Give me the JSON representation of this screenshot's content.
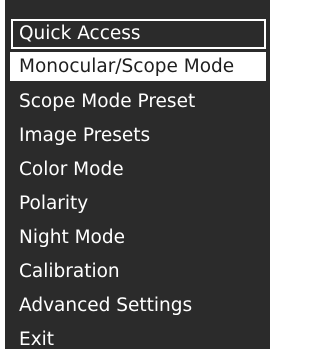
{
  "menu": {
    "title": "Quick Access",
    "items": [
      {
        "label": "Monocular/Scope Mode",
        "selected": true
      },
      {
        "label": "Scope Mode Preset",
        "selected": false
      },
      {
        "label": "Image Presets",
        "selected": false
      },
      {
        "label": "Color Mode",
        "selected": false
      },
      {
        "label": "Polarity",
        "selected": false
      },
      {
        "label": "Night Mode",
        "selected": false
      },
      {
        "label": "Calibration",
        "selected": false
      },
      {
        "label": "Advanced Settings",
        "selected": false
      },
      {
        "label": "Exit",
        "selected": false
      }
    ]
  },
  "colors": {
    "panel_background": "#2b2b2b",
    "text": "#ffffff",
    "selected_background": "#ffffff",
    "selected_text": "#1e1e1e"
  }
}
